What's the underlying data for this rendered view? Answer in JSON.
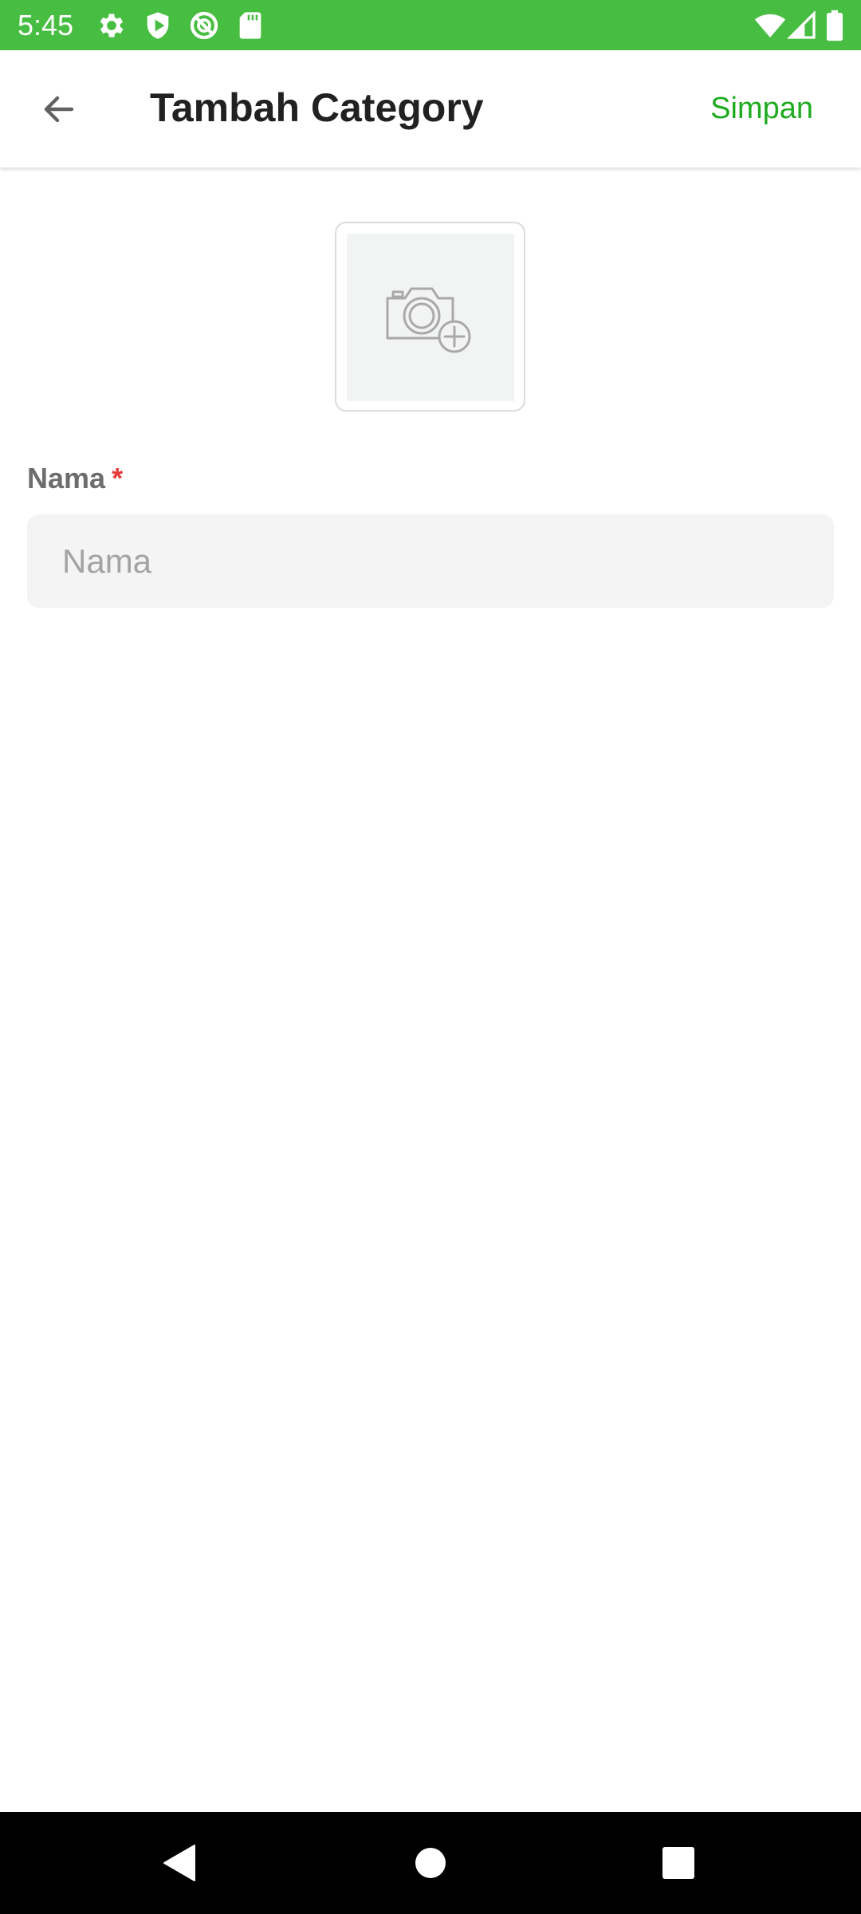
{
  "status_bar": {
    "time": "5:45",
    "background_color": "#47be41",
    "left_icons": [
      "settings-icon",
      "shield-play-icon",
      "no-disturb-icon",
      "sd-card-icon"
    ],
    "right_icons": [
      "wifi-icon",
      "cellular-signal-icon",
      "battery-icon"
    ]
  },
  "app_bar": {
    "back_icon": "arrow-left-icon",
    "title": "Tambah Category",
    "save_label": "Simpan",
    "accent_color": "#1fab1f"
  },
  "image_picker": {
    "icon": "camera-add-icon"
  },
  "form": {
    "name_label": "Nama",
    "required_mark": "*",
    "name_placeholder": "Nama",
    "name_value": ""
  },
  "nav_bar": {
    "icons": [
      "back-triangle-icon",
      "home-circle-icon",
      "recents-square-icon"
    ]
  }
}
